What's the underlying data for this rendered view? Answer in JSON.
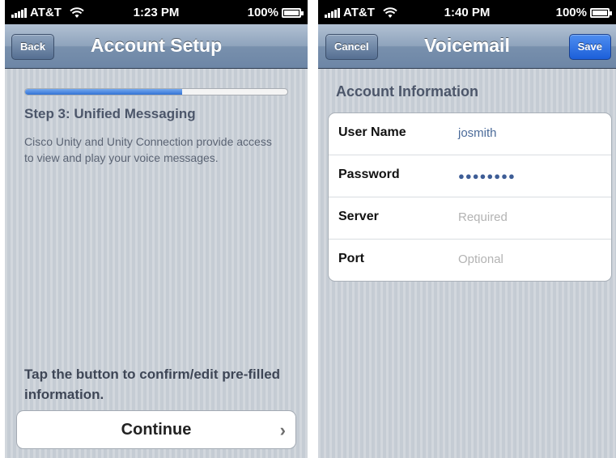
{
  "left": {
    "status": {
      "carrier": "AT&T",
      "time": "1:23 PM",
      "battery": "100%"
    },
    "nav": {
      "back_label": "Back",
      "title": "Account Setup"
    },
    "progress_fraction": 0.6,
    "step_title": "Step 3: Unified Messaging",
    "step_desc": "Cisco Unity and Unity Connection provide access to view and play your voice messages.",
    "bottom_hint": "Tap the button to confirm/edit pre-filled information.",
    "continue_label": "Continue",
    "continue_chevron": "›"
  },
  "right": {
    "status": {
      "carrier": "AT&T",
      "time": "1:40 PM",
      "battery": "100%"
    },
    "nav": {
      "cancel_label": "Cancel",
      "title": "Voicemail",
      "save_label": "Save"
    },
    "section_title": "Account Information",
    "fields": [
      {
        "label": "User Name",
        "value": "josmith",
        "placeholder": ""
      },
      {
        "label": "Password",
        "value": "●●●●●●●●",
        "placeholder": ""
      },
      {
        "label": "Server",
        "value": "",
        "placeholder": "Required"
      },
      {
        "label": "Port",
        "value": "",
        "placeholder": "Optional"
      }
    ]
  },
  "colors": {
    "accent_progress": "#3272d4",
    "save_button": "#1c5fd9",
    "nav_bar": "#7890ad",
    "background": "#c5ccd4"
  }
}
